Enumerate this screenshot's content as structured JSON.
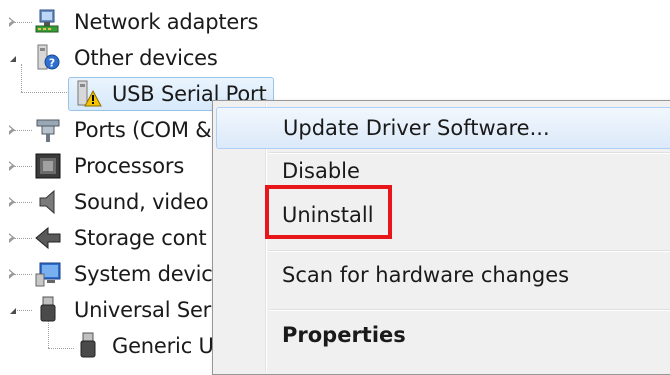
{
  "tree": {
    "items": [
      {
        "label": "Network adapters",
        "icon": "network-adapter-icon",
        "expander": "closed"
      },
      {
        "label": "Other devices",
        "icon": "unknown-device-icon",
        "expander": "open"
      },
      {
        "label": "USB Serial Port",
        "icon": "warning-device-icon",
        "expander": "none"
      },
      {
        "label": "Ports (COM &",
        "icon": "port-icon",
        "expander": "closed"
      },
      {
        "label": "Processors",
        "icon": "processor-icon",
        "expander": "closed"
      },
      {
        "label": "Sound, video",
        "icon": "speaker-icon",
        "expander": "closed"
      },
      {
        "label": "Storage cont",
        "icon": "storage-controller-icon",
        "expander": "closed"
      },
      {
        "label": "System devic",
        "icon": "system-device-icon",
        "expander": "closed"
      },
      {
        "label": "Universal Ser",
        "icon": "usb-icon",
        "expander": "open"
      },
      {
        "label": "Generic U",
        "icon": "usb-icon",
        "expander": "none"
      }
    ],
    "selected_item": "USB Serial Port"
  },
  "context_menu": {
    "items": [
      {
        "label": "Update Driver Software...",
        "style": "hover"
      },
      {
        "label": "Disable",
        "style": "normal"
      },
      {
        "label": "Uninstall",
        "style": "normal",
        "annotated": true
      },
      {
        "label": "Scan for hardware changes",
        "style": "normal"
      },
      {
        "label": "Properties",
        "style": "bold"
      }
    ]
  },
  "colors": {
    "annotation_box": "#e8151b",
    "menu_background": "#f0f0f0",
    "hover_border": "#aecff7"
  }
}
